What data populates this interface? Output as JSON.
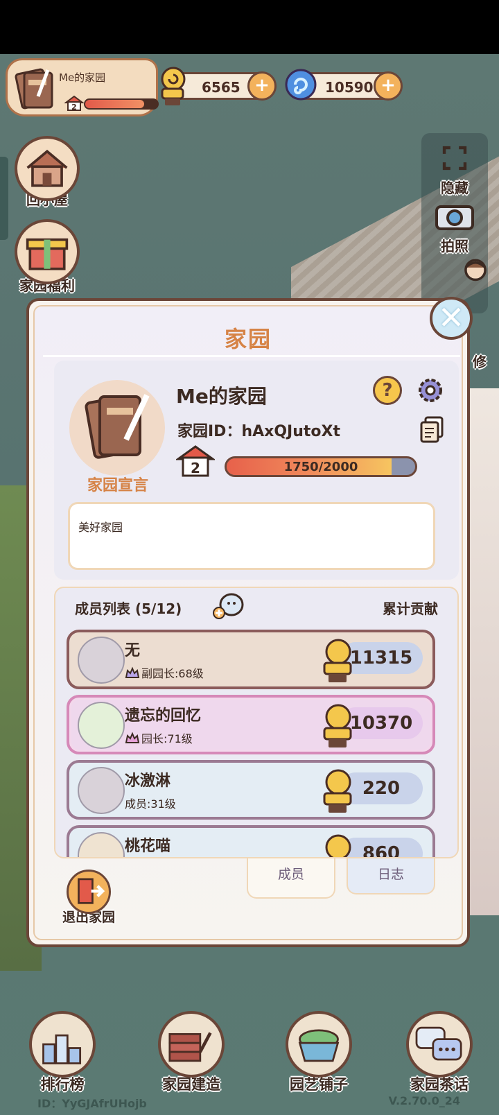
{
  "hud": {
    "garden_name": "Me的家园",
    "garden_level": "2",
    "garden_exp_fraction": 0.82,
    "snail_coins": "6565",
    "crystals": "10590",
    "plus": "+"
  },
  "left_buttons": [
    {
      "label": "回小屋"
    },
    {
      "label": "家园福利"
    }
  ],
  "right_buttons": [
    {
      "label": "隐藏"
    },
    {
      "label": "拍照"
    },
    {
      "label": "修"
    }
  ],
  "dialog": {
    "title": "家园",
    "close": "✕",
    "info": {
      "name": "Me的家园",
      "id_label": "家园ID：hAxQJutoXt",
      "help": "?",
      "level": "2",
      "exp_text": "1750/2000",
      "exp_current": 1750,
      "exp_max": 2000,
      "manifesto_label": "家园宣言",
      "manifesto_text": "美好家园"
    },
    "members": {
      "header_left": "成员列表 (5/12)",
      "header_right": "累计贡献",
      "list": [
        {
          "name": "无",
          "role": "副园长:68级",
          "score": "11315"
        },
        {
          "name": "遗忘的回忆",
          "role": "园长:71级",
          "score": "10370"
        },
        {
          "name": "冰激淋",
          "role": "成员:31级",
          "score": "220"
        },
        {
          "name": "桃花喵",
          "role": "",
          "score": "860"
        }
      ]
    },
    "tabs": [
      {
        "label": "成员",
        "active": true
      },
      {
        "label": "日志",
        "active": false
      }
    ],
    "exit_label": "退出家园"
  },
  "bottom_nav": [
    {
      "label": "排行榜"
    },
    {
      "label": "家园建造"
    },
    {
      "label": "园艺铺子"
    },
    {
      "label": "家园茶话"
    }
  ],
  "footer": {
    "id": "ID：YyGJAfrUHojb",
    "version": "V.2.70.0_24"
  },
  "colors": {
    "accent_orange": "#d68346",
    "border_brown": "#6b4638",
    "background": "#5f7b74"
  }
}
